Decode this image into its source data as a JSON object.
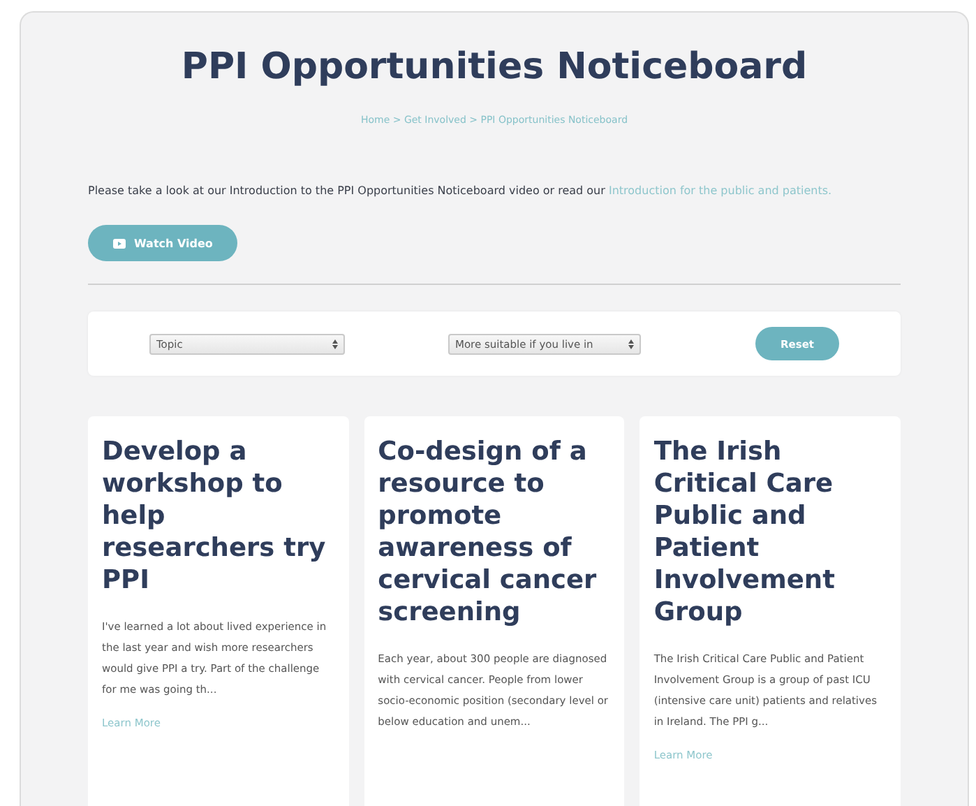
{
  "title": "PPI Opportunities Noticeboard",
  "breadcrumb": "Home > Get Involved > PPI Opportunities Noticeboard",
  "intro": {
    "text": "Please take a look at our Introduction to the PPI Opportunities Noticeboard video or read our ",
    "link": "Introduction for the public and patients."
  },
  "watch_button": "Watch Video",
  "filters": {
    "selects": [
      {
        "value": "Topic"
      },
      {
        "value": "More suitable if you live in"
      }
    ],
    "reset": "Reset"
  },
  "cards": [
    {
      "title": "Develop a workshop to help researchers try PPI",
      "excerpt": "I've learned a lot about lived experience in the last year and wish more researchers would give PPI a try. Part of the challenge for me was going th...",
      "link": "Learn More"
    },
    {
      "title": "Co-design of a resource to promote awareness of cervical cancer screening",
      "excerpt": "Each year, about 300 people are diagnosed with cervical cancer. People from lower socio-economic position (secondary level or below education and unem..."
    },
    {
      "title": "The Irish Critical Care Public and Patient Involvement Group",
      "excerpt": "The Irish Critical Care Public and Patient Involvement Group is a group of past ICU (intensive care unit) patients and relatives in Ireland. The PPI g...",
      "link": "Learn More"
    }
  ]
}
